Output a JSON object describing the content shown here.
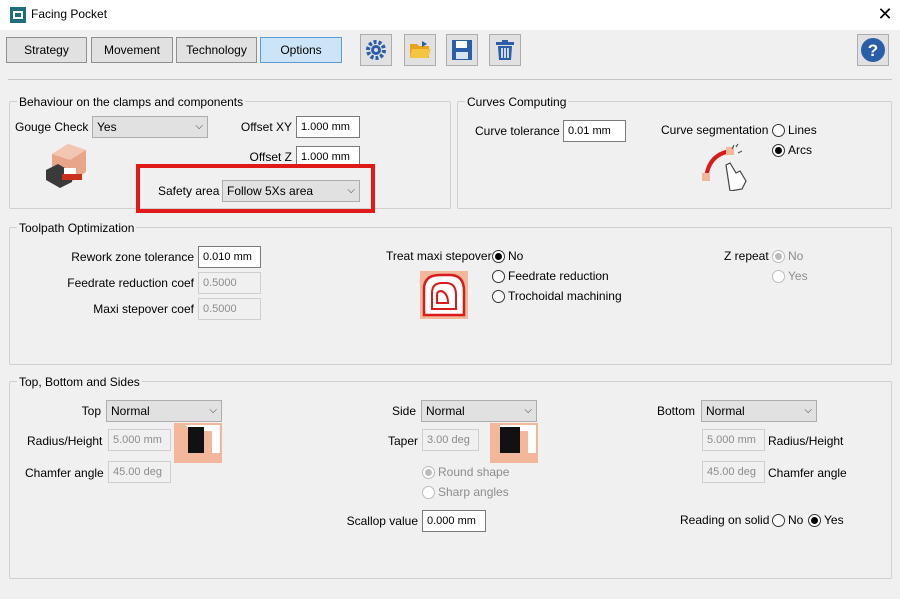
{
  "window": {
    "title": "Facing Pocket",
    "close_symbol": "✕"
  },
  "tabs": [
    {
      "label": "Strategy",
      "active": false
    },
    {
      "label": "Movement",
      "active": false
    },
    {
      "label": "Technology",
      "active": false
    },
    {
      "label": "Options",
      "active": true
    }
  ],
  "toolbar": {
    "icons": [
      "settings-gear-icon",
      "open-folder-icon",
      "save-disk-icon",
      "delete-trash-icon"
    ],
    "help_icon": "help-icon",
    "help_symbol": "?"
  },
  "behaviour": {
    "title": "Behaviour on the clamps and components",
    "gouge_check_label": "Gouge Check",
    "gouge_check_value": "Yes",
    "offset_xy_label": "Offset XY",
    "offset_xy_value": "1.000 mm",
    "offset_z_label": "Offset Z",
    "offset_z_value": "1.000 mm",
    "safety_area_label": "Safety area",
    "safety_area_value": "Follow 5Xs area"
  },
  "curves": {
    "title": "Curves Computing",
    "curve_tolerance_label": "Curve tolerance",
    "curve_tolerance_value": "0.01 mm",
    "curve_segmentation_label": "Curve segmentation",
    "options": [
      {
        "label": "Lines",
        "selected": false
      },
      {
        "label": "Arcs",
        "selected": true
      }
    ]
  },
  "toolpath": {
    "title": "Toolpath Optimization",
    "rework_label": "Rework zone tolerance",
    "rework_value": "0.010 mm",
    "feedrate_coef_label": "Feedrate reduction coef",
    "feedrate_coef_value": "0.5000",
    "maxi_coef_label": "Maxi stepover coef",
    "maxi_coef_value": "0.5000",
    "treat_label": "Treat maxi stepover",
    "treat_options": [
      {
        "label": "No",
        "selected": true
      },
      {
        "label": "Feedrate reduction",
        "selected": false
      },
      {
        "label": "Trochoidal machining",
        "selected": false
      }
    ],
    "z_repeat_label": "Z repeat",
    "z_repeat_options": [
      {
        "label": "No",
        "selected": true
      },
      {
        "label": "Yes",
        "selected": false
      }
    ]
  },
  "sides": {
    "title": "Top, Bottom and Sides",
    "top_label": "Top",
    "top_value": "Normal",
    "radius_height_label": "Radius/Height",
    "top_radius_value": "5.000 mm",
    "chamfer_label": "Chamfer angle",
    "top_chamfer_value": "45.00 deg",
    "side_label": "Side",
    "side_value": "Normal",
    "taper_label": "Taper",
    "taper_value": "3.00 deg",
    "shape_options": [
      {
        "label": "Round shape",
        "selected": true
      },
      {
        "label": "Sharp angles",
        "selected": false
      }
    ],
    "scallop_label": "Scallop value",
    "scallop_value": "0.000 mm",
    "bottom_label": "Bottom",
    "bottom_value": "Normal",
    "bottom_radius_value": "5.000 mm",
    "bottom_chamfer_value": "45.00 deg",
    "reading_label": "Reading on solid",
    "reading_options": [
      {
        "label": "No",
        "selected": false
      },
      {
        "label": "Yes",
        "selected": true
      }
    ]
  },
  "colors": {
    "highlight": "#e11919",
    "active_tab": "#cce4f7",
    "icon_blue": "#2a5ea8"
  }
}
